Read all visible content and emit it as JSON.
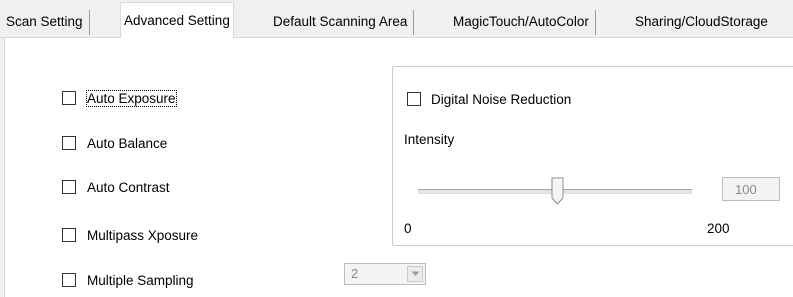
{
  "tabs": [
    {
      "label": "Scan Setting",
      "active": false
    },
    {
      "label": "Advanced Setting",
      "active": true
    },
    {
      "label": "Default Scanning Area",
      "active": false
    },
    {
      "label": "MagicTouch/AutoColor",
      "active": false
    },
    {
      "label": "Sharing/CloudStorage",
      "active": false
    }
  ],
  "options": {
    "auto_exposure": {
      "label": "Auto Exposure",
      "checked": false
    },
    "auto_balance": {
      "label": "Auto Balance",
      "checked": false
    },
    "auto_contrast": {
      "label": "Auto Contrast",
      "checked": false
    },
    "multipass_xposure": {
      "label": "Multipass Xposure",
      "checked": false
    },
    "multiple_sampling": {
      "label": "Multiple Sampling",
      "checked": false,
      "value": "2"
    }
  },
  "noise_reduction": {
    "label": "Digital Noise Reduction",
    "checked": false,
    "intensity_label": "Intensity",
    "min_label": "0",
    "max_label": "200",
    "value": "100",
    "slider_min": 0,
    "slider_max": 200,
    "slider_value": 100
  },
  "colors": {
    "panel_bg": "#ffffff",
    "window_bg": "#f0f0f0",
    "border": "#d9d9d9",
    "disabled_text": "#8a8a8a"
  }
}
